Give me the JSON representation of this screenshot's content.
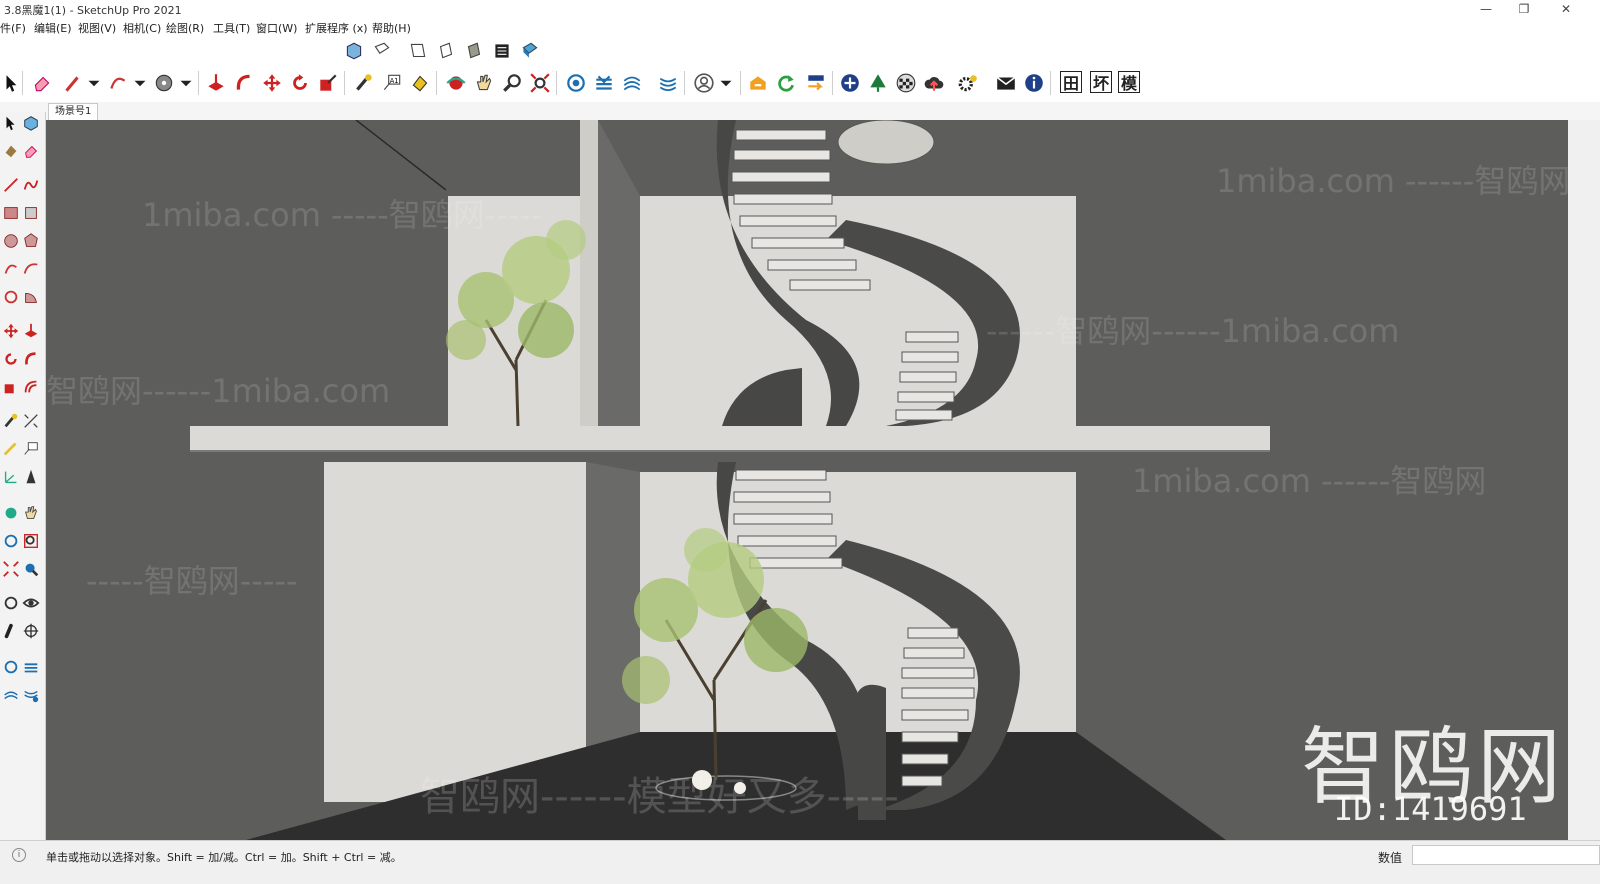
{
  "window": {
    "title": "3.8黑魔1(1) - SketchUp Pro 2021"
  },
  "menu": [
    "件(F)",
    "编辑(E)",
    "视图(V)",
    "相机(C)",
    "绘图(R)",
    "工具(T)",
    "窗口(W)",
    "扩展程序 (x)",
    "帮助(H)"
  ],
  "toolbar": {
    "text_buttons": [
      "田",
      "坏",
      "模"
    ],
    "icons_row1": [
      "iso-view-icon",
      "top-view-icon",
      "front-view-icon",
      "right-view-icon",
      "back-view-icon",
      "left-view-icon",
      "bottom-view-icon"
    ],
    "icons_row2": [
      "select-icon",
      "eraser-icon",
      "pencil-icon",
      "arc-icon",
      "circle-icon",
      "push-pull-icon",
      "follow-me-icon",
      "move-icon",
      "rotate-icon",
      "scale-icon",
      "tape-icon",
      "text-icon",
      "paint-icon",
      "orbit-icon",
      "pan-icon",
      "zoom-icon",
      "zoom-extents-icon",
      "section-icon",
      "layers-icon",
      "sandbox-icon",
      "user-icon",
      "warehouse-icon",
      "refresh-icon",
      "export-icon",
      "add-icon",
      "tree-icon",
      "checker-icon",
      "cloud-icon",
      "settings-icon",
      "mail-icon",
      "info-icon"
    ]
  },
  "scene_tab": "场景号1",
  "status": {
    "hint": "单击或拖动以选择对象。Shift = 加/减。Ctrl = 加。Shift + Ctrl = 减。",
    "measure_label": "数值",
    "measure_value": ""
  },
  "watermarks": {
    "brand": "智鸥网",
    "slogan": "智鸥网------模型好又多-----",
    "site": "1miba.com",
    "line1": "1miba.com -----智鸥网-----",
    "line2": "智鸥网------1miba.com",
    "line3": "------智鸥网------1miba.com",
    "line4": "1miba.com ------智鸥网",
    "line5": "-----智鸥网-----",
    "big_brand": "智鸥网",
    "id": "ID:1419691"
  },
  "colors": {
    "viewport_bg": "#5d5d5b",
    "wall": "#dcdad6",
    "floor": "#2e2e2e",
    "stair_wood": "#4a4a48",
    "accent_blue": "#1c8fd6"
  }
}
